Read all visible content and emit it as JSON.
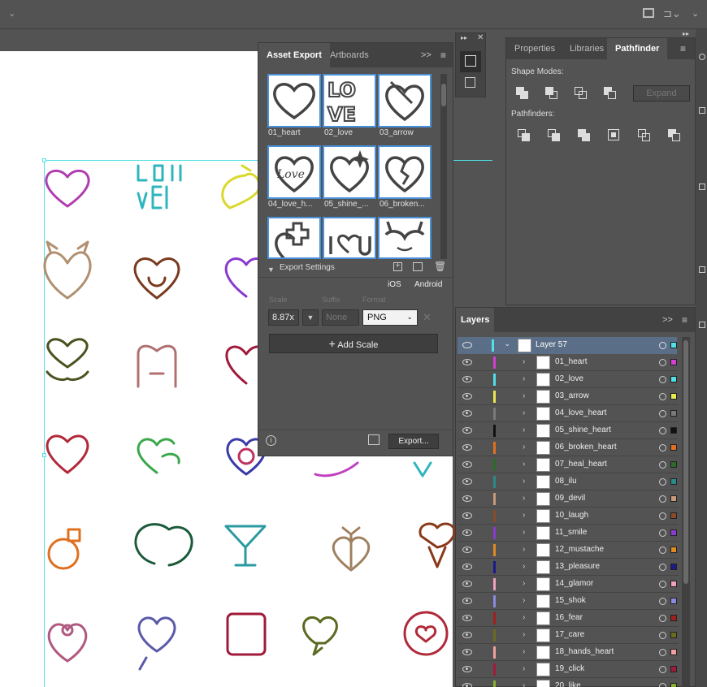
{
  "asset_export": {
    "tab_asset_export": "Asset Export",
    "tab_artboards": "Artboards",
    "menu": ">>",
    "assets": [
      "01_heart",
      "02_love",
      "03_arrow",
      "04_love_h...",
      "05_shine_...",
      "06_broken..."
    ],
    "export_settings": "Export Settings",
    "ios": "iOS",
    "android": "Android",
    "scale_label": "Scale",
    "suffix_label": "Suffix",
    "format_label": "Format",
    "scale_value": "8.87x",
    "suffix_placeholder": "None",
    "format_value": "PNG",
    "add_scale": "Add Scale",
    "export_button": "Export..."
  },
  "right_panel": {
    "tab_properties": "Properties",
    "tab_libraries": "Libraries",
    "tab_pathfinder": "Pathfinder",
    "shape_modes": "Shape Modes:",
    "expand": "Expand",
    "pathfinders": "Pathfinders:"
  },
  "layers": {
    "title": "Layers",
    "menu": ">>",
    "parent": "Layer 57",
    "items": [
      {
        "name": "01_heart",
        "color": "#d33fd3"
      },
      {
        "name": "02_love",
        "color": "#4fe0e8"
      },
      {
        "name": "03_arrow",
        "color": "#e8e84f"
      },
      {
        "name": "04_love_heart",
        "color": "#7a7a7a"
      },
      {
        "name": "05_shine_heart",
        "color": "#111111"
      },
      {
        "name": "06_broken_heart",
        "color": "#e07020"
      },
      {
        "name": "07_heal_heart",
        "color": "#2a6b2a"
      },
      {
        "name": "08_ilu",
        "color": "#2a8a8a"
      },
      {
        "name": "09_devil",
        "color": "#c79a7a"
      },
      {
        "name": "10_laugh",
        "color": "#8a4a2a"
      },
      {
        "name": "11_smile",
        "color": "#8a3ad0"
      },
      {
        "name": "12_mustache",
        "color": "#e08a20"
      },
      {
        "name": "13_pleasure",
        "color": "#1a1a8a"
      },
      {
        "name": "14_glamor",
        "color": "#f0a0c0"
      },
      {
        "name": "15_shok",
        "color": "#8a8ae0"
      },
      {
        "name": "16_fear",
        "color": "#a02020"
      },
      {
        "name": "17_care",
        "color": "#6a6a20"
      },
      {
        "name": "18_hands_heart",
        "color": "#f0a0a0"
      },
      {
        "name": "19_click",
        "color": "#a01a3a"
      },
      {
        "name": "20_like",
        "color": "#8ab030"
      }
    ]
  },
  "colors": {
    "guide": "#4fe0e8",
    "selection": "#4a90d9"
  }
}
